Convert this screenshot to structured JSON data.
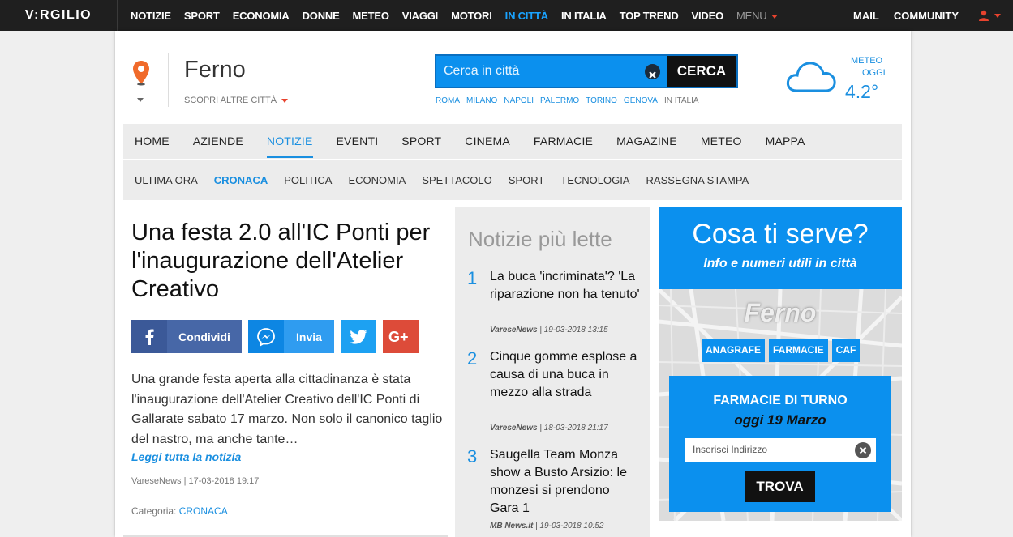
{
  "topbar": {
    "logo": "V:RGILIO",
    "items": [
      "NOTIZIE",
      "SPORT",
      "ECONOMIA",
      "DONNE",
      "METEO",
      "VIAGGI",
      "MOTORI",
      "IN CITTÀ",
      "IN ITALIA",
      "TOP TREND",
      "VIDEO"
    ],
    "active": "IN CITTÀ",
    "menu": "MENU",
    "right": [
      "MAIL",
      "COMMUNITY"
    ],
    "accent": "#1aa3ff"
  },
  "city": {
    "name": "Ferno",
    "more": "SCOPRI ALTRE CITTÀ"
  },
  "search": {
    "placeholder": "Cerca in città",
    "button": "CERCA",
    "cities": [
      "ROMA",
      "MILANO",
      "NAPOLI",
      "PALERMO",
      "TORINO",
      "GENOVA"
    ],
    "italia": "IN ITALIA"
  },
  "meteo": {
    "label1": "METEO",
    "label2": "OGGI",
    "temp": "4.2°",
    "icon": "cloud-icon"
  },
  "mainnav": [
    "HOME",
    "AZIENDE",
    "NOTIZIE",
    "EVENTI",
    "SPORT",
    "CINEMA",
    "FARMACIE",
    "MAGAZINE",
    "METEO",
    "MAPPA"
  ],
  "subnav": [
    "ULTIMA ORA",
    "CRONACA",
    "POLITICA",
    "ECONOMIA",
    "SPETTACOLO",
    "SPORT",
    "TECNOLOGIA",
    "RASSEGNA STAMPA"
  ],
  "article": {
    "title": "Una festa 2.0 all'IC Ponti per l'inaugurazione dell'Atelier Creativo",
    "share_fb": "Condividi",
    "share_ms": "Invia",
    "body": "Una grande festa aperta alla cittadinanza è stata l'inaugurazione dell'Atelier Creativo dell'IC Ponti di Gallarate sabato 17 marzo. Non solo il canonico taglio del nastro, ma anche tante…",
    "readmore": "Leggi tutta la notizia",
    "meta": "VareseNews | 17-03-2018 19:17",
    "cat_label": "Categoria: ",
    "cat": "CRONACA"
  },
  "mostread": {
    "title": "Notizie più lette",
    "items": [
      {
        "num": "1",
        "title": "La buca 'incriminata'? 'La riparazione non ha tenuto'",
        "source": "VareseNews",
        "date": " | 19-03-2018 13:15"
      },
      {
        "num": "2",
        "title": "Cinque gomme esplose a causa di una buca in mezzo alla strada",
        "source": "VareseNews",
        "date": " | 18-03-2018 21:17"
      },
      {
        "num": "3",
        "title": "Saugella Team Monza show a Busto Arsizio: le monzesi si prendono Gara 1",
        "source": "MB News.it",
        "date": " | 19-03-2018 10:52"
      }
    ]
  },
  "widget": {
    "title": "Cosa ti serve?",
    "subtitle": "Info e numeri utili in città",
    "city": "Ferno",
    "buttons": [
      "ANAGRAFE",
      "FARMACIE",
      "CAF"
    ],
    "farm_title": "FARMACIE DI TURNO",
    "farm_date": "oggi 19 Marzo",
    "farm_placeholder": "Inserisci Indirizzo",
    "farm_button": "TROVA",
    "color": "#0b90ee"
  }
}
